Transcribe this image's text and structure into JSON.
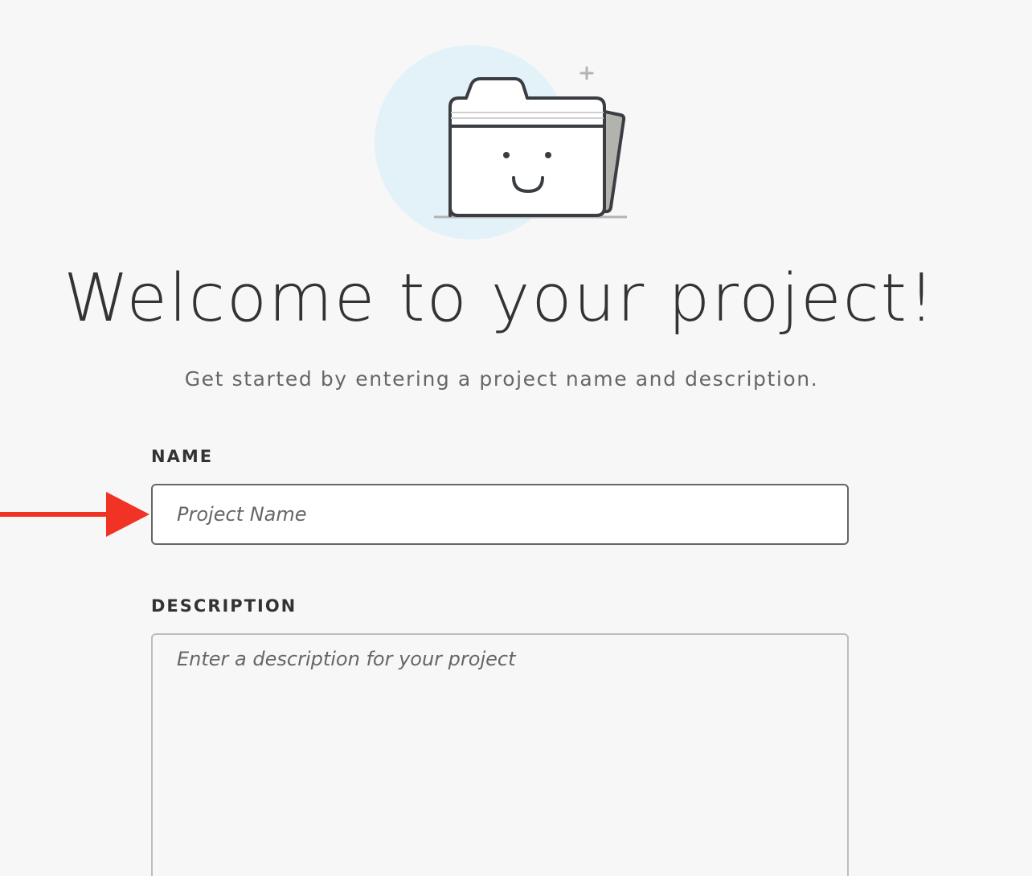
{
  "hero": {
    "title": "Welcome to your project!",
    "subtitle": "Get started by entering a project name and description.",
    "illustration_icon": "smiling-folder-icon"
  },
  "form": {
    "name": {
      "label": "NAME",
      "value": "",
      "placeholder": "Project Name"
    },
    "description": {
      "label": "DESCRIPTION",
      "value": "",
      "placeholder": "Enter a description for your project"
    }
  },
  "annotation": {
    "icon": "arrow-right-icon",
    "color": "#f03324"
  },
  "colors": {
    "background": "#f7f7f7",
    "circle": "#e3f2f8",
    "folder_stroke": "#3a3d42",
    "text_dark": "#333333",
    "text_muted": "#666666"
  }
}
